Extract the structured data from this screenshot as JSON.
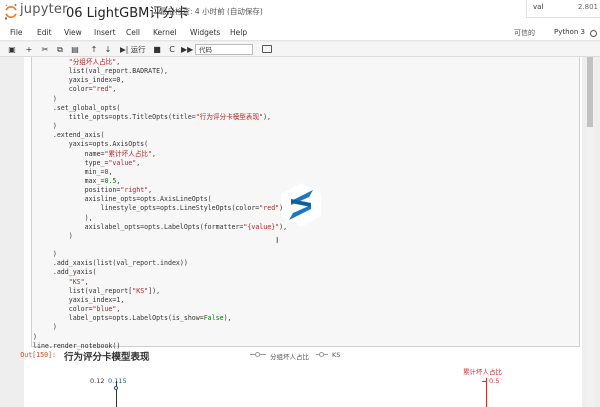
{
  "header": {
    "logo_text": "jupyter",
    "notebook_title": "06 LightGBM评分卡",
    "checkpoint": "最后检查: 4 小时前 (自动保存)",
    "topright_key": "val",
    "topright_value": "2.801"
  },
  "menubar": {
    "items": [
      "File",
      "Edit",
      "View",
      "Insert",
      "Cell",
      "Kernel",
      "Widgets",
      "Help"
    ],
    "trusted": "可信的",
    "kernel": "Python 3"
  },
  "toolbar": {
    "run_label": "▶| 运行",
    "cell_type": "代码"
  },
  "code": [
    {
      "segments": [
        [
          "         ",
          ""
        ],
        [
          "\"分组坏人占比\"",
          "s"
        ],
        [
          ",",
          ""
        ]
      ]
    },
    {
      "segments": [
        [
          "         list(val_report.BADRATE),",
          ""
        ]
      ]
    },
    {
      "segments": [
        [
          "         yaxis_index=0,",
          ""
        ]
      ]
    },
    {
      "segments": [
        [
          "         color=",
          ""
        ],
        [
          "\"red\"",
          "s"
        ],
        [
          ",",
          ""
        ]
      ]
    },
    {
      "segments": [
        [
          "     )",
          ""
        ]
      ]
    },
    {
      "segments": [
        [
          "     .set_global_opts(",
          ""
        ]
      ]
    },
    {
      "segments": [
        [
          "         title_opts=opts.TitleOpts(title=",
          ""
        ],
        [
          "\"行为评分卡模型表现\"",
          "s"
        ],
        [
          "),",
          ""
        ]
      ]
    },
    {
      "segments": [
        [
          "     )",
          ""
        ]
      ]
    },
    {
      "segments": [
        [
          "     .extend_axis(",
          ""
        ]
      ]
    },
    {
      "segments": [
        [
          "         yaxis=opts.AxisOpts(",
          ""
        ]
      ]
    },
    {
      "segments": [
        [
          "             name=",
          ""
        ],
        [
          "\"累计坏人占比\"",
          "s"
        ],
        [
          ",",
          ""
        ]
      ]
    },
    {
      "segments": [
        [
          "             type_=",
          ""
        ],
        [
          "\"value\"",
          "s"
        ],
        [
          ",",
          ""
        ]
      ]
    },
    {
      "segments": [
        [
          "             min_=",
          ""
        ],
        [
          "0",
          "g"
        ],
        [
          ",",
          ""
        ]
      ]
    },
    {
      "segments": [
        [
          "             max_=",
          ""
        ],
        [
          "0.5",
          "g"
        ],
        [
          ",",
          ""
        ]
      ]
    },
    {
      "segments": [
        [
          "             position=",
          ""
        ],
        [
          "\"right\"",
          "s"
        ],
        [
          ",",
          ""
        ]
      ]
    },
    {
      "segments": [
        [
          "             axisline_opts=opts.AxisLineOpts(",
          ""
        ]
      ]
    },
    {
      "segments": [
        [
          "                 linestyle_opts=opts.LineStyleOpts(color=",
          ""
        ],
        [
          "\"red\"",
          "s"
        ],
        [
          ")",
          ""
        ]
      ]
    },
    {
      "segments": [
        [
          "             ),",
          ""
        ]
      ]
    },
    {
      "segments": [
        [
          "             axislabel_opts=opts.LabelOpts(formatter=",
          ""
        ],
        [
          "\"{value}\"",
          "s"
        ],
        [
          "),",
          ""
        ]
      ]
    },
    {
      "segments": [
        [
          "         )",
          ""
        ]
      ]
    },
    {
      "segments": [
        [
          "",
          ""
        ]
      ]
    },
    {
      "segments": [
        [
          "     )",
          ""
        ]
      ]
    },
    {
      "segments": [
        [
          "     .add_xaxis(list(val_report.index))",
          ""
        ]
      ]
    },
    {
      "segments": [
        [
          "     .add_yaxis(",
          ""
        ]
      ]
    },
    {
      "segments": [
        [
          "         ",
          ""
        ],
        [
          "\"KS\"",
          "s"
        ],
        [
          ",",
          ""
        ]
      ]
    },
    {
      "segments": [
        [
          "         list(val_report[",
          ""
        ],
        [
          "\"KS\"",
          "s"
        ],
        [
          "]),",
          ""
        ]
      ]
    },
    {
      "segments": [
        [
          "         yaxis_index=1,",
          ""
        ]
      ]
    },
    {
      "segments": [
        [
          "         color=",
          ""
        ],
        [
          "\"blue\"",
          "s"
        ],
        [
          ",",
          ""
        ]
      ]
    },
    {
      "segments": [
        [
          "         label_opts=opts.LabelOpts(is_show=",
          ""
        ],
        [
          "False",
          "g"
        ],
        [
          "),",
          ""
        ]
      ]
    },
    {
      "segments": [
        [
          "     )",
          ""
        ]
      ]
    },
    {
      "segments": [
        [
          ")",
          ""
        ]
      ]
    },
    {
      "segments": [
        [
          "line.render_notebook()",
          ""
        ]
      ]
    }
  ],
  "output": {
    "prompt": "Out[150]:",
    "chart_title": "行为评分卡模型表现",
    "legend_1": "分组坏人占比",
    "legend_2": "KS",
    "right_axis_name": "累计坏人占比",
    "right_axis_tick": "0.5",
    "left_axis_tick": "0.12",
    "point_label": "0.115"
  },
  "colors": {
    "string": "#ba2121",
    "number": "#008000",
    "red_axis": "#d32f2f",
    "blue_series": "#1e5ca8"
  }
}
